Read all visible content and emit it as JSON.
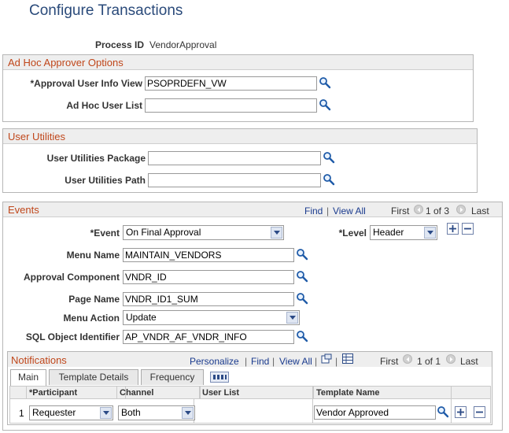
{
  "page": {
    "title": "Configure Transactions"
  },
  "process": {
    "label": "Process ID",
    "value": "VendorApproval"
  },
  "adhoc": {
    "header": "Ad Hoc Approver Options",
    "approval_label": "*Approval User Info View",
    "approval_value": "PSOPRDEFN_VW",
    "userlist_label": "Ad Hoc User List",
    "userlist_value": ""
  },
  "utilities": {
    "header": "User Utilities",
    "package_label": "User Utilities Package",
    "package_value": "",
    "path_label": "User Utilities Path",
    "path_value": ""
  },
  "events": {
    "header": "Events",
    "find": "Find",
    "sep": "|",
    "view_all": "View All",
    "first": "First",
    "count": "1 of 3",
    "last": "Last",
    "event_label": "*Event",
    "event_value": "On Final Approval",
    "level_label": "*Level",
    "level_value": "Header",
    "menu_name_label": "Menu Name",
    "menu_name_value": "MAINTAIN_VENDORS",
    "component_label": "Approval Component",
    "component_value": "VNDR_ID",
    "page_name_label": "Page Name",
    "page_name_value": "VNDR_ID1_SUM",
    "menu_action_label": "Menu Action",
    "menu_action_value": "Update",
    "sql_label": "SQL Object Identifier",
    "sql_value": "AP_VNDR_AF_VNDR_INFO"
  },
  "notifications": {
    "header": "Notifications",
    "personalize": "Personalize",
    "find": "Find",
    "view_all": "View All",
    "sep": "|",
    "first": "First",
    "count": "1 of 1",
    "last": "Last",
    "tabs": [
      "Main",
      "Template Details",
      "Frequency"
    ],
    "columns": [
      "*Participant",
      "Channel",
      "User List",
      "Template Name"
    ],
    "rows": [
      {
        "num": "1",
        "participant": "Requester",
        "channel": "Both",
        "user_list": "",
        "template": "Vendor Approved"
      }
    ]
  },
  "colors": {
    "title": "#2a4a7a",
    "section_header": "#c0471b",
    "link": "#1a3b8e"
  }
}
